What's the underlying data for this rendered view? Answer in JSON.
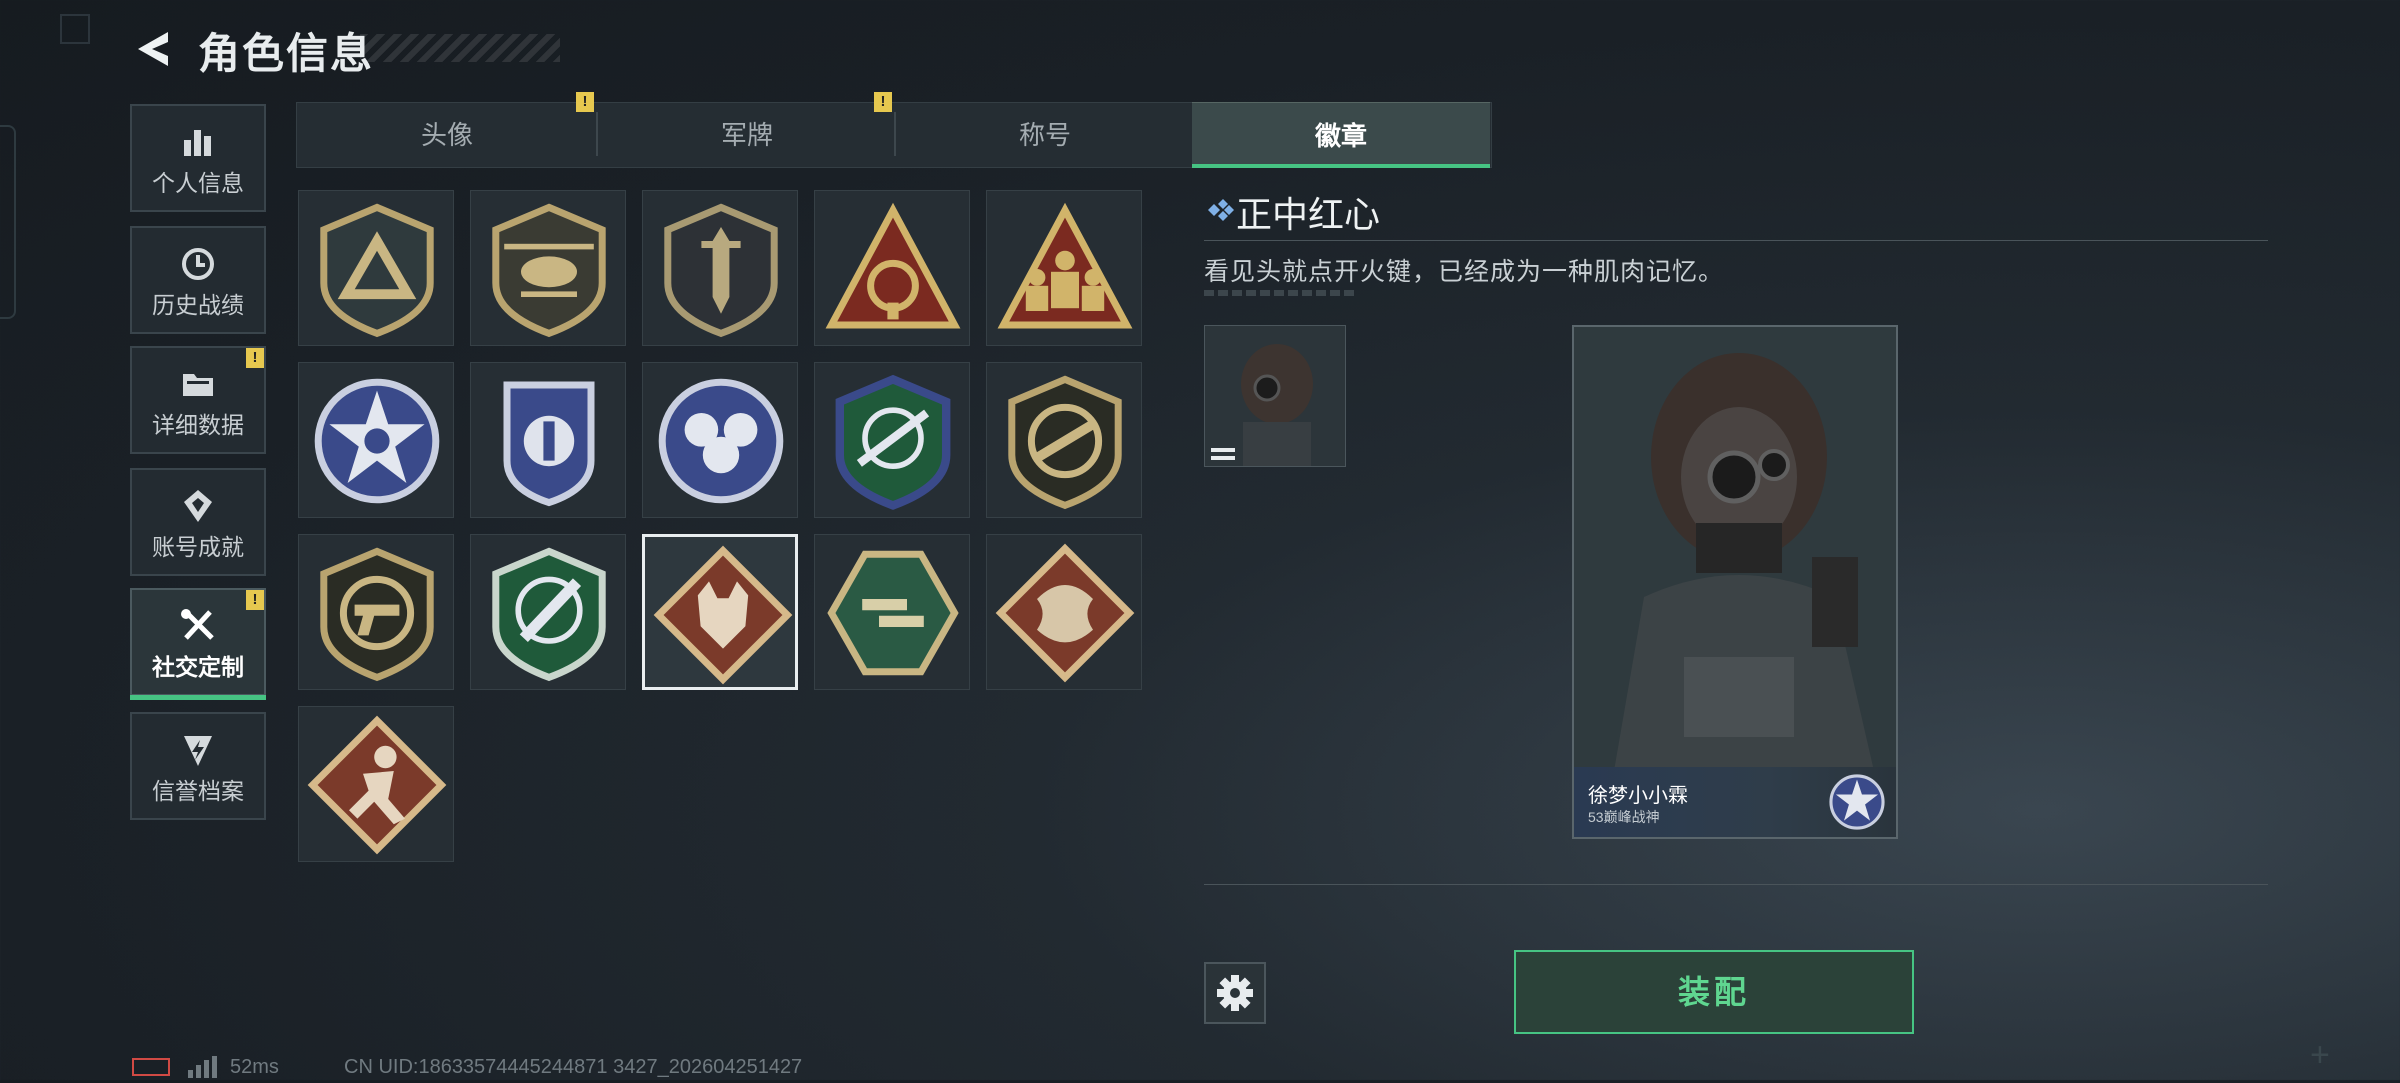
{
  "header": {
    "title": "角色信息"
  },
  "sidebar": {
    "items": [
      {
        "label": "个人信息",
        "icon": "bar-chart-icon",
        "alert": false,
        "active": false
      },
      {
        "label": "历史战绩",
        "icon": "clock-icon",
        "alert": false,
        "active": false
      },
      {
        "label": "详细数据",
        "icon": "folder-icon",
        "alert": true,
        "active": false
      },
      {
        "label": "账号成就",
        "icon": "achievement-icon",
        "alert": false,
        "active": false
      },
      {
        "label": "社交定制",
        "icon": "tools-icon",
        "alert": true,
        "active": true
      },
      {
        "label": "信誉档案",
        "icon": "shield-bolt-icon",
        "alert": false,
        "active": false
      }
    ],
    "alert_mark": "!"
  },
  "tabs": [
    {
      "label": "头像",
      "alert": true,
      "active": false
    },
    {
      "label": "军牌",
      "alert": true,
      "active": false
    },
    {
      "label": "称号",
      "alert": false,
      "active": false
    },
    {
      "label": "徽章",
      "alert": false,
      "active": true
    }
  ],
  "badges": [
    {
      "icon": "arrow-shield-badge-icon"
    },
    {
      "icon": "helicopter-badge-icon"
    },
    {
      "icon": "dagger-shield-badge-icon"
    },
    {
      "icon": "globe-triangle-badge-icon"
    },
    {
      "icon": "soldiers-triangle-badge-icon"
    },
    {
      "icon": "skull-star-badge-icon"
    },
    {
      "icon": "ribbon-shield-badge-icon"
    },
    {
      "icon": "skulls-badge-icon"
    },
    {
      "icon": "rifle-crosshair-badge-icon"
    },
    {
      "icon": "smg-circle-badge-icon"
    },
    {
      "icon": "pistol-circle-badge-icon"
    },
    {
      "icon": "knife-crosshair-badge-icon"
    },
    {
      "icon": "wolf-diamond-badge-icon",
      "selected": true
    },
    {
      "icon": "guns-hexagon-badge-icon"
    },
    {
      "icon": "dragon-diamond-badge-icon"
    },
    {
      "icon": "runner-diamond-badge-icon"
    }
  ],
  "detail": {
    "title": "正中红心",
    "description": "看见头就点开火键，已经成为一种肌肉记忆。"
  },
  "card": {
    "player_name": "徐梦小小霖",
    "rank_text": "53巅峰战神"
  },
  "actions": {
    "equip_label": "装配"
  },
  "status": {
    "ping": "52ms",
    "uid": "CN UID:18633574445244871 3427_202604251427"
  },
  "colors": {
    "accent": "#46c483",
    "alert": "#e6c84f",
    "battery": "#d14a44"
  }
}
